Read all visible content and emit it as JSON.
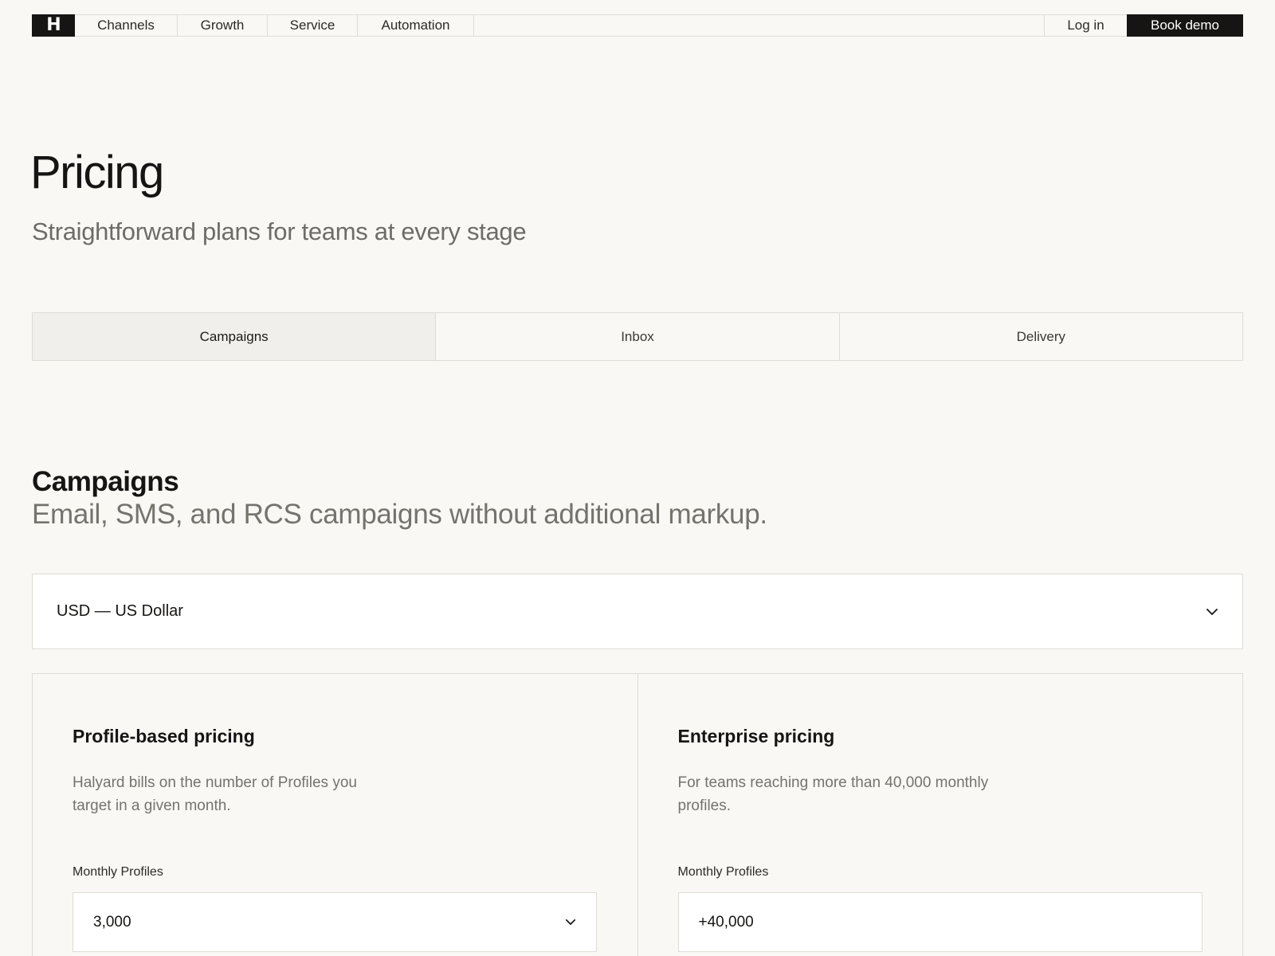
{
  "nav": {
    "logo_alt": "H",
    "items": [
      {
        "label": "Channels"
      },
      {
        "label": "Growth"
      },
      {
        "label": "Service"
      },
      {
        "label": "Automation"
      }
    ],
    "login_label": "Log in",
    "demo_label": "Book demo"
  },
  "hero": {
    "title": "Pricing",
    "subtitle": "Straightforward plans for teams at every stage"
  },
  "tabs": [
    {
      "label": "Campaigns",
      "active": true
    },
    {
      "label": "Inbox",
      "active": false
    },
    {
      "label": "Delivery",
      "active": false
    }
  ],
  "section": {
    "title": "Campaigns",
    "subtitle": "Email, SMS, and RCS campaigns without additional markup."
  },
  "currency": {
    "value": "USD — US Dollar",
    "icon": "chevron-down-icon"
  },
  "cards": [
    {
      "title": "Profile-based pricing",
      "description": "Halyard bills on the number of Profiles you target in a given month.",
      "field_label": "Monthly Profiles",
      "field_value": "3,000",
      "has_dropdown": true
    },
    {
      "title": "Enterprise pricing",
      "description": "For teams reaching more than 40,000 monthly profiles.",
      "field_label": "Monthly Profiles",
      "field_value": "+40,000",
      "has_dropdown": false
    }
  ],
  "colors": {
    "background": "#f9f8f5",
    "primary_dark": "#161513",
    "muted_text": "#75736c",
    "border": "#dedcd5",
    "active_tab_bg": "#f1efeb"
  }
}
